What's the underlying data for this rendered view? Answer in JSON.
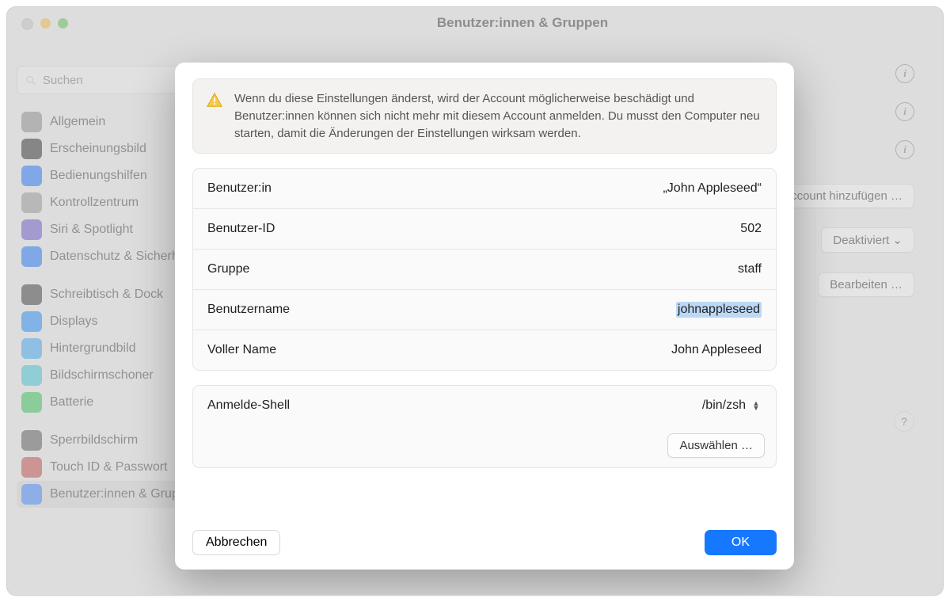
{
  "window": {
    "title": "Benutzer:innen & Gruppen"
  },
  "search": {
    "placeholder": "Suchen"
  },
  "sidebar": {
    "items": [
      {
        "label": "Allgemein",
        "color": "#8e8e8e"
      },
      {
        "label": "Erscheinungsbild",
        "color": "#2b2b2b"
      },
      {
        "label": "Bedienungshilfen",
        "color": "#1f77ff"
      },
      {
        "label": "Kontrollzentrum",
        "color": "#9a9a9a"
      },
      {
        "label": "Siri & Spotlight",
        "color": "#6a5acd"
      },
      {
        "label": "Datenschutz & Sicherheit",
        "color": "#1f77ff"
      },
      {
        "label": "Schreibtisch & Dock",
        "color": "#3b3b3b"
      },
      {
        "label": "Displays",
        "color": "#1f8fff"
      },
      {
        "label": "Hintergrundbild",
        "color": "#3fa9f5"
      },
      {
        "label": "Bildschirmschoner",
        "color": "#40c8d8"
      },
      {
        "label": "Batterie",
        "color": "#34c759"
      },
      {
        "label": "Sperrbildschirm",
        "color": "#5a5a5a"
      },
      {
        "label": "Touch ID & Passwort",
        "color": "#c84a4a"
      },
      {
        "label": "Benutzer:innen & Gruppen",
        "color": "#3a84ff"
      }
    ]
  },
  "background": {
    "add_account": "Account hinzufügen …",
    "deactivated": "Deaktiviert",
    "edit": "Bearbeiten …"
  },
  "modal": {
    "warning": "Wenn du diese Einstellungen änderst, wird der Account möglicherweise beschädigt und Benutzer:innen können sich nicht mehr mit diesem Account anmelden. Du musst den Computer neu starten, damit die Änderungen der Einstellungen wirksam werden.",
    "rows": {
      "user_label": "Benutzer:in",
      "user_value": "„John Appleseed“",
      "uid_label": "Benutzer-ID",
      "uid_value": "502",
      "group_label": "Gruppe",
      "group_value": "staff",
      "username_label": "Benutzername",
      "username_value": "johnappleseed",
      "fullname_label": "Voller Name",
      "fullname_value": "John Appleseed",
      "shell_label": "Anmelde-Shell",
      "shell_value": "/bin/zsh"
    },
    "select_button": "Auswählen …",
    "cancel": "Abbrechen",
    "ok": "OK"
  }
}
